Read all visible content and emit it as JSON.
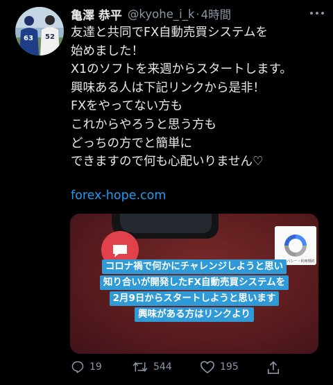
{
  "user": {
    "name": "亀澤 恭平",
    "handle": "@kyohe_i_k",
    "separator": "·",
    "time": "4時間",
    "avatar_jersey_numbers": [
      "63",
      "52"
    ]
  },
  "tweet": {
    "lines": [
      "友達と共同でFX自動売買システムを",
      "始めました！",
      "X1のソフトを来週からスタートします。",
      "興味ある人は下記リンクから是非！",
      "FXをやってない方も",
      "これからやろうと思う方も",
      "どっちの方でと簡単に",
      "できますので何も心配いりません♡"
    ],
    "link": "forex-hope.com"
  },
  "card": {
    "subtitles": [
      "コロナ禍で何かにチャレンジしようと思い",
      "知り合いが開発したFX自動売買システムを",
      "2月9日からスタートしようと思います",
      "興味がある方はリンクより"
    ],
    "captcha_text": "プライバシー・利用規約"
  },
  "actions": {
    "reply_count": "19",
    "retweet_count": "544",
    "like_count": "195"
  },
  "colors": {
    "background": "#000000",
    "text": "#e7e9ea",
    "secondary": "#8b98a5",
    "link": "#1d9bf0",
    "subtitle_bg": "#2f9ad6",
    "card_bg": "#5a1c1e",
    "chat_bubble": "#e0414b"
  },
  "icons": {
    "more": "more-dots-icon",
    "reply": "reply-icon",
    "retweet": "retweet-icon",
    "like": "heart-icon",
    "share": "share-icon",
    "chat": "chat-bubble-icon",
    "captcha": "recaptcha-icon"
  }
}
